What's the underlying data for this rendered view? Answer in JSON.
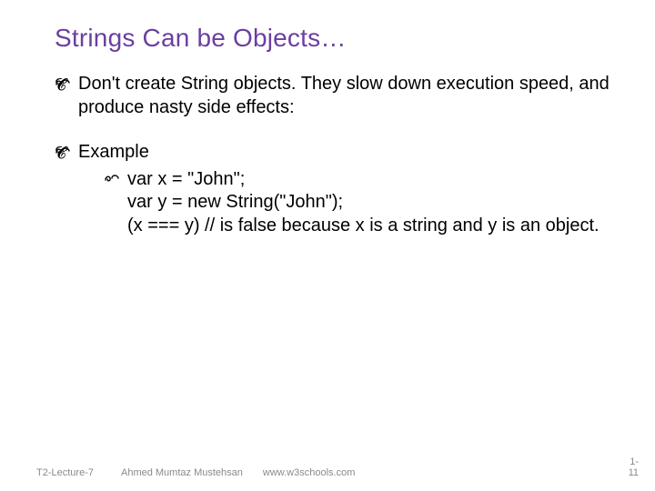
{
  "title": "Strings Can be Objects…",
  "bullets": {
    "b1": "Don't create String objects. They slow down execution speed, and produce nasty side effects:",
    "b2": "Example",
    "b2a_l1": "var x = \"John\";",
    "b2a_l2": "var y = new String(\"John\");",
    "b2a_l3": "(x === y) // is false because x is a string and y is an object."
  },
  "footer": {
    "left": "T2-Lecture-7",
    "author": "Ahmed Mumtaz Mustehsan",
    "site": "www.w3schools.com",
    "page_top": "1-",
    "page_bottom": "11"
  }
}
